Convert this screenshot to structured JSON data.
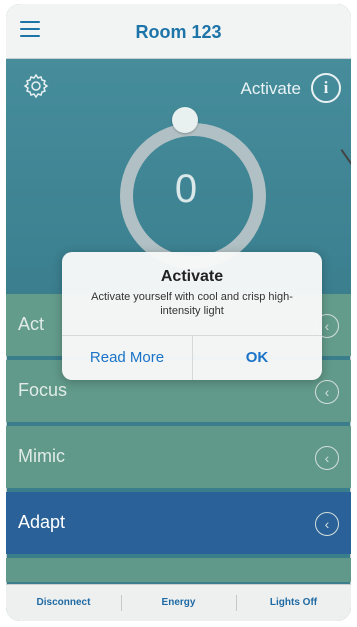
{
  "navbar": {
    "title": "Room 123",
    "menu_icon": "hamburger-icon"
  },
  "hero": {
    "settings_icon": "gear-icon",
    "mode_label": "Activate",
    "info_icon_glyph": "i",
    "dial_value": "0"
  },
  "modes": [
    {
      "label": "Act",
      "state": "dimmed"
    },
    {
      "label": "Focus",
      "state": "normal"
    },
    {
      "label": "Mimic",
      "state": "normal"
    },
    {
      "label": "Adapt",
      "state": "selected"
    }
  ],
  "chevron_glyph": "‹",
  "alert": {
    "title": "Activate",
    "message": "Activate yourself with cool and crisp high-intensity light",
    "read_more": "Read More",
    "ok": "OK"
  },
  "toolbar": {
    "disconnect": "Disconnect",
    "energy": "Energy",
    "lights_off": "Lights Off"
  },
  "colors": {
    "accent": "#1d74a8",
    "hero_bg": "#206e80",
    "mode_row": "#4a8a7a",
    "selected_row": "#0c4c8a"
  }
}
